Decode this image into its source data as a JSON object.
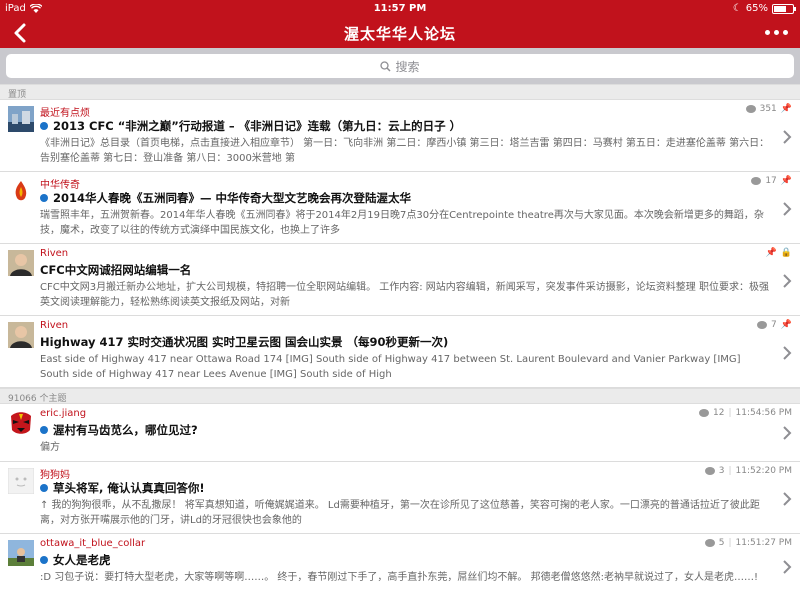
{
  "status_bar": {
    "device": "iPad",
    "time": "11:57 PM",
    "battery": "65%",
    "battery_level": 0.65
  },
  "nav": {
    "title": "渥太华华人论坛"
  },
  "search": {
    "placeholder": "搜索"
  },
  "sections": {
    "pinned_header": "置顶",
    "topics_header": "91066 个主题"
  },
  "pinned": [
    {
      "author": "最近有点烦",
      "replies": "351",
      "title": "2013 CFC “非洲之巅”行动报道 – 《非洲日记》连载（第九日：云上的日子 ）",
      "excerpt": "《非洲日记》总目录（首页电梯，点击直接进入相应章节） 第一日：飞向非洲 第二日：摩西小镇 第三日：塔兰吉雷 第四日：马赛村 第五日：走进塞伦盖蒂 第六日：告别塞伦盖蒂 第七日：登山准备 第八日：3000米营地 第"
    },
    {
      "author": "中华传奇",
      "replies": "17",
      "title": "2014华人春晚《五洲同春》— 中华传奇大型文艺晚会再次登陆渥太华",
      "excerpt": "瑞雪照丰年，五洲贺新春。2014年华人春晚《五洲同春》将于2014年2月19日晚7点30分在Centrepointe theatre再次与大家见面。本次晚会新增更多的舞蹈，杂技，魔术，改变了以往的传统方式演绎中国民族文化，也换上了许多"
    },
    {
      "author": "Riven",
      "replies": "",
      "title": "CFC中文网诚招网站编辑一名",
      "excerpt": "CFC中文网3月搬迁新办公地址，扩大公司规模，特招聘一位全职网站编辑。 工作内容: 网站内容编辑，新闻采写，突发事件采访摄影，论坛资料整理 职位要求：极强英文阅读理解能力，轻松熟练阅读英文报纸及网站，对新"
    },
    {
      "author": "Riven",
      "replies": "7",
      "title": "Highway 417 实时交通状况图 实时卫星云图 国会山实景 （每90秒更新一次)",
      "excerpt": "East side of Highway 417 near Ottawa Road 174 [IMG] South side of Highway 417 between St. Laurent Boulevard and Vanier Parkway [IMG] South side of Highway 417 near Lees Avenue [IMG] South side of High"
    }
  ],
  "topics": [
    {
      "author": "eric.jiang",
      "replies": "12",
      "time": "11:54:56 PM",
      "title": "渥村有马齿苋么，哪位见过?",
      "excerpt": "偏方"
    },
    {
      "author": "狗狗妈",
      "replies": "3",
      "time": "11:52:20 PM",
      "title": "草头将军, 俺认认真真回答你!",
      "excerpt": "↑ 我的狗狗很乖，从不乱撒尿！ 将军真想知道，听俺娓娓道来。 Ld需要种植牙，第一次在诊所见了这位慈善，笑容可掬的老人家。一口漂亮的普通话拉近了彼此距离，对方张开嘴展示他的门牙，讲Ld的牙冠很快也会象他的"
    },
    {
      "author": "ottawa_it_blue_collar",
      "replies": "5",
      "time": "11:51:27 PM",
      "title": "女人是老虎",
      "excerpt": ":D 习包子说：要打特大型老虎，大家等啊等啊……。 终于，春节刚过下手了，高手直扑东莞，屌丝们均不解。 邦德老僧悠悠然:老衲早就说过了，女人是老虎……!"
    }
  ]
}
